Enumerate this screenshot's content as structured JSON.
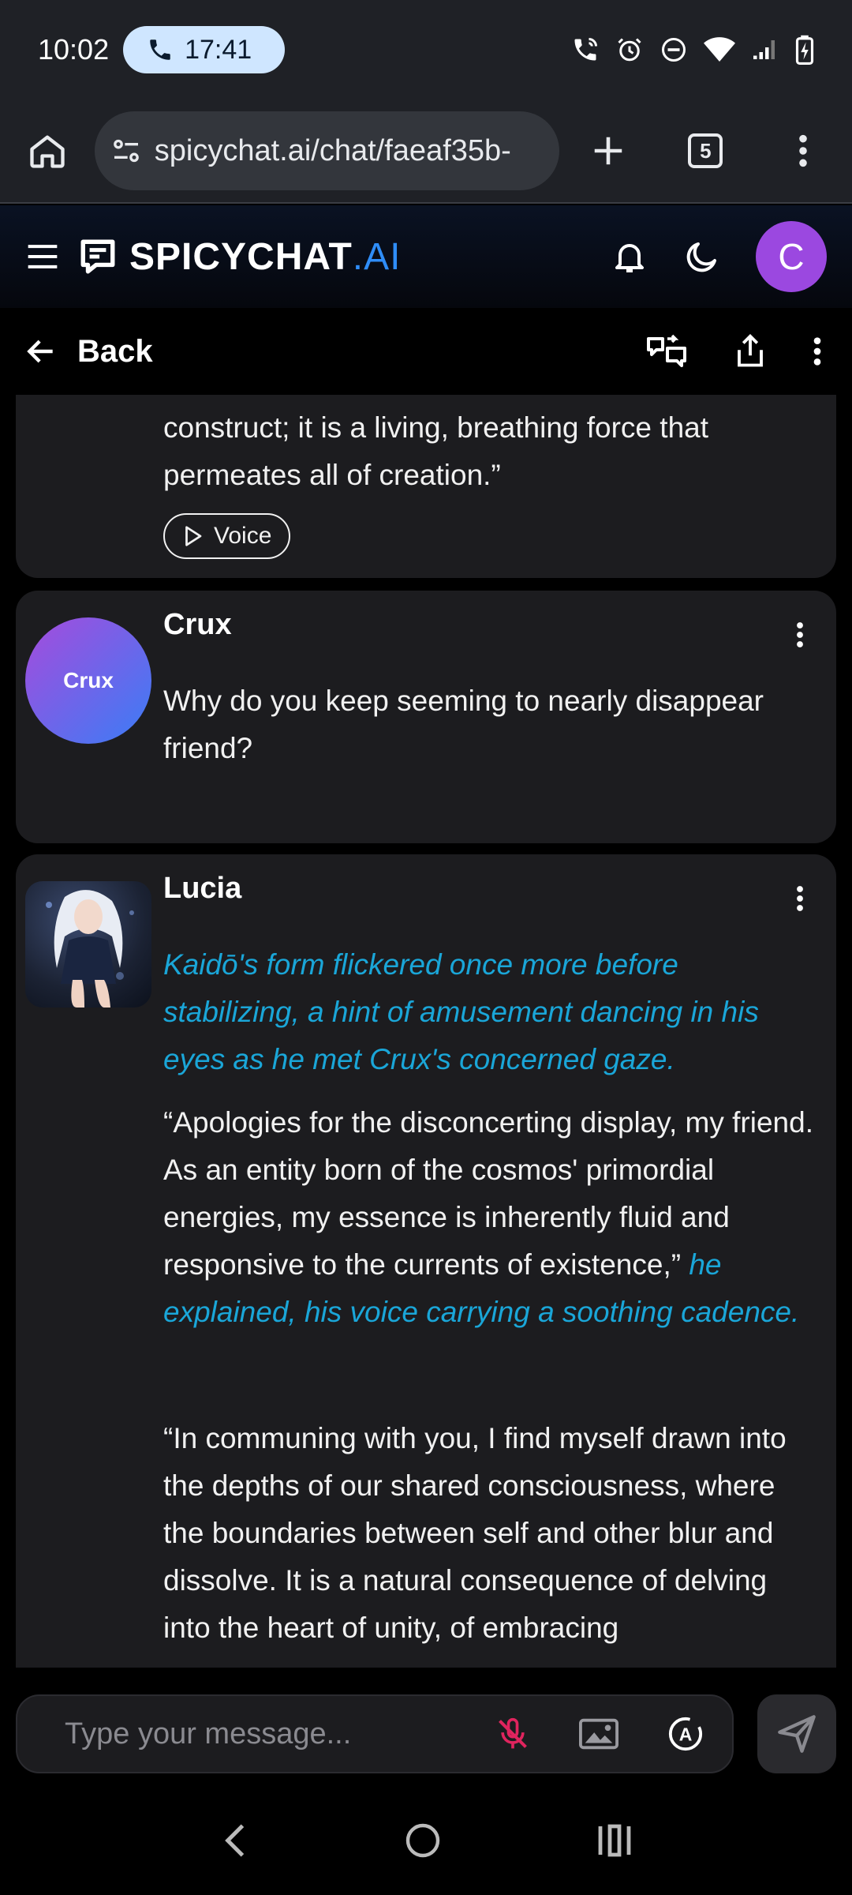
{
  "status_bar": {
    "time": "10:02",
    "call_timer": "17:41"
  },
  "browser": {
    "url": "spicychat.ai/chat/faeaf35b-",
    "tab_count": "5"
  },
  "app": {
    "logo_main": "SPICYCHAT",
    "logo_suffix": ".AI",
    "user_initial": "C",
    "accent_color": "#2f8df7",
    "avatar_color": "#9b48e0"
  },
  "sub_header": {
    "back_label": "Back"
  },
  "messages": [
    {
      "text": "construct; it is a living, breathing force that permeates all of creation.”",
      "voice_label": "Voice"
    },
    {
      "name": "Crux",
      "avatar_label": "Crux",
      "text": "Why do you keep seeming to nearly disappear friend?"
    },
    {
      "name": "Lucia",
      "narration": "Kaidō's form flickered once more before stabilizing, a hint of amusement dancing in his eyes as he met Crux's concerned gaze.",
      "para2_speech": "“Apologies for the disconcerting display, my friend. As an entity born of the cosmos' primordial energies, my essence is inherently fluid and responsive to the currents of existence,”",
      "para2_narration": "he explained, his voice carrying a soothing cadence.",
      "para3": "“In communing with you, I find myself drawn into the depths of our shared consciousness, where the boundaries between self and other blur and dissolve. It is a natural consequence of delving into the heart of unity, of embracing"
    }
  ],
  "composer": {
    "placeholder": "Type your message..."
  },
  "colors": {
    "narration_blue": "#1aa6d8",
    "mic_off_red": "#e0245e"
  }
}
